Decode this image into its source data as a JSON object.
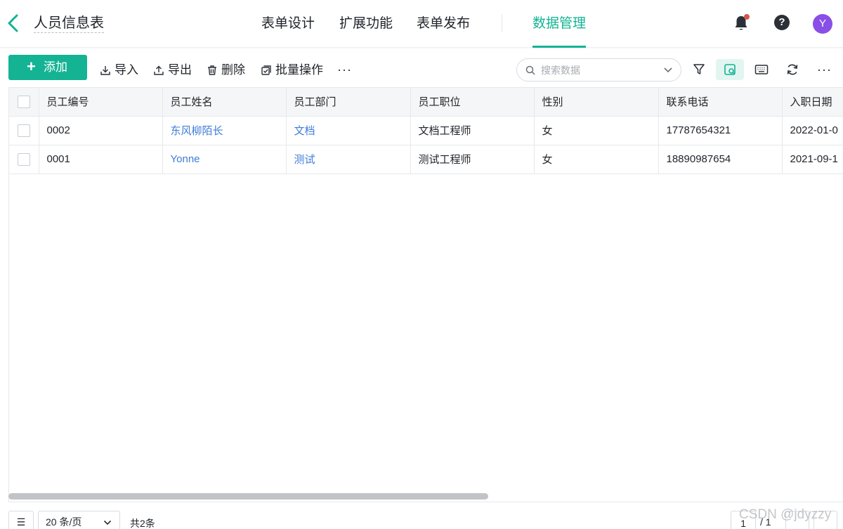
{
  "header": {
    "form_title": "人员信息表",
    "nav": [
      "表单设计",
      "扩展功能",
      "表单发布",
      "数据管理"
    ],
    "active_nav": "数据管理",
    "avatar_letter": "Y",
    "accent_color": "#14b394"
  },
  "toolbar": {
    "add_label": "添加",
    "import_label": "导入",
    "export_label": "导出",
    "delete_label": "删除",
    "batch_label": "批量操作",
    "more_label": "···",
    "search_placeholder": "搜索数据",
    "more_right_label": "···"
  },
  "table": {
    "columns": [
      "员工编号",
      "员工姓名",
      "员工部门",
      "员工职位",
      "性别",
      "联系电话",
      "入职日期"
    ],
    "rows": [
      [
        "0002",
        "东风柳陌长",
        "文档",
        "文档工程师",
        "女",
        "17787654321",
        "2022-01-0"
      ],
      [
        "0001",
        "Yonne",
        "测试",
        "测试工程师",
        "女",
        "18890987654",
        "2021-09-1"
      ]
    ]
  },
  "footer": {
    "page_size": "20 条/页",
    "total": "共2条",
    "current_page": "1",
    "total_pages": "/ 1"
  },
  "watermark": "CSDN @jdyzzy"
}
